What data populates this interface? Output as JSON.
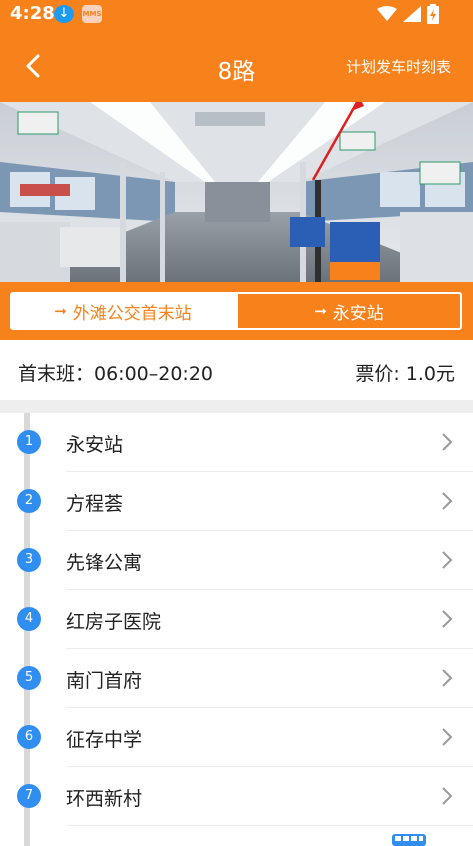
{
  "status": {
    "time": "4:28",
    "mms_label": "MMS"
  },
  "header": {
    "title": "8路",
    "schedule_link": "计划发车时刻表"
  },
  "directions": [
    {
      "label": "外滩公交首末站",
      "selected": false
    },
    {
      "label": "永安站",
      "selected": true
    }
  ],
  "info": {
    "first_last": "首末班：06:00–20:20",
    "fare": "票价: 1.0元"
  },
  "stops": [
    {
      "num": "1",
      "name": "永安站"
    },
    {
      "num": "2",
      "name": "方程荟"
    },
    {
      "num": "3",
      "name": "先锋公寓"
    },
    {
      "num": "4",
      "name": "红房子医院"
    },
    {
      "num": "5",
      "name": "南门首府"
    },
    {
      "num": "6",
      "name": "征存中学"
    },
    {
      "num": "7",
      "name": "环西新村"
    }
  ],
  "colors": {
    "accent": "#f7821b",
    "stop_badge": "#2f8ef0",
    "annotation": "#e02020"
  },
  "icons": [
    "download-icon",
    "mms-icon",
    "wifi-icon",
    "signal-icon",
    "battery-icon",
    "back-arrow-icon",
    "chevron-right-icon",
    "bus-icon"
  ]
}
